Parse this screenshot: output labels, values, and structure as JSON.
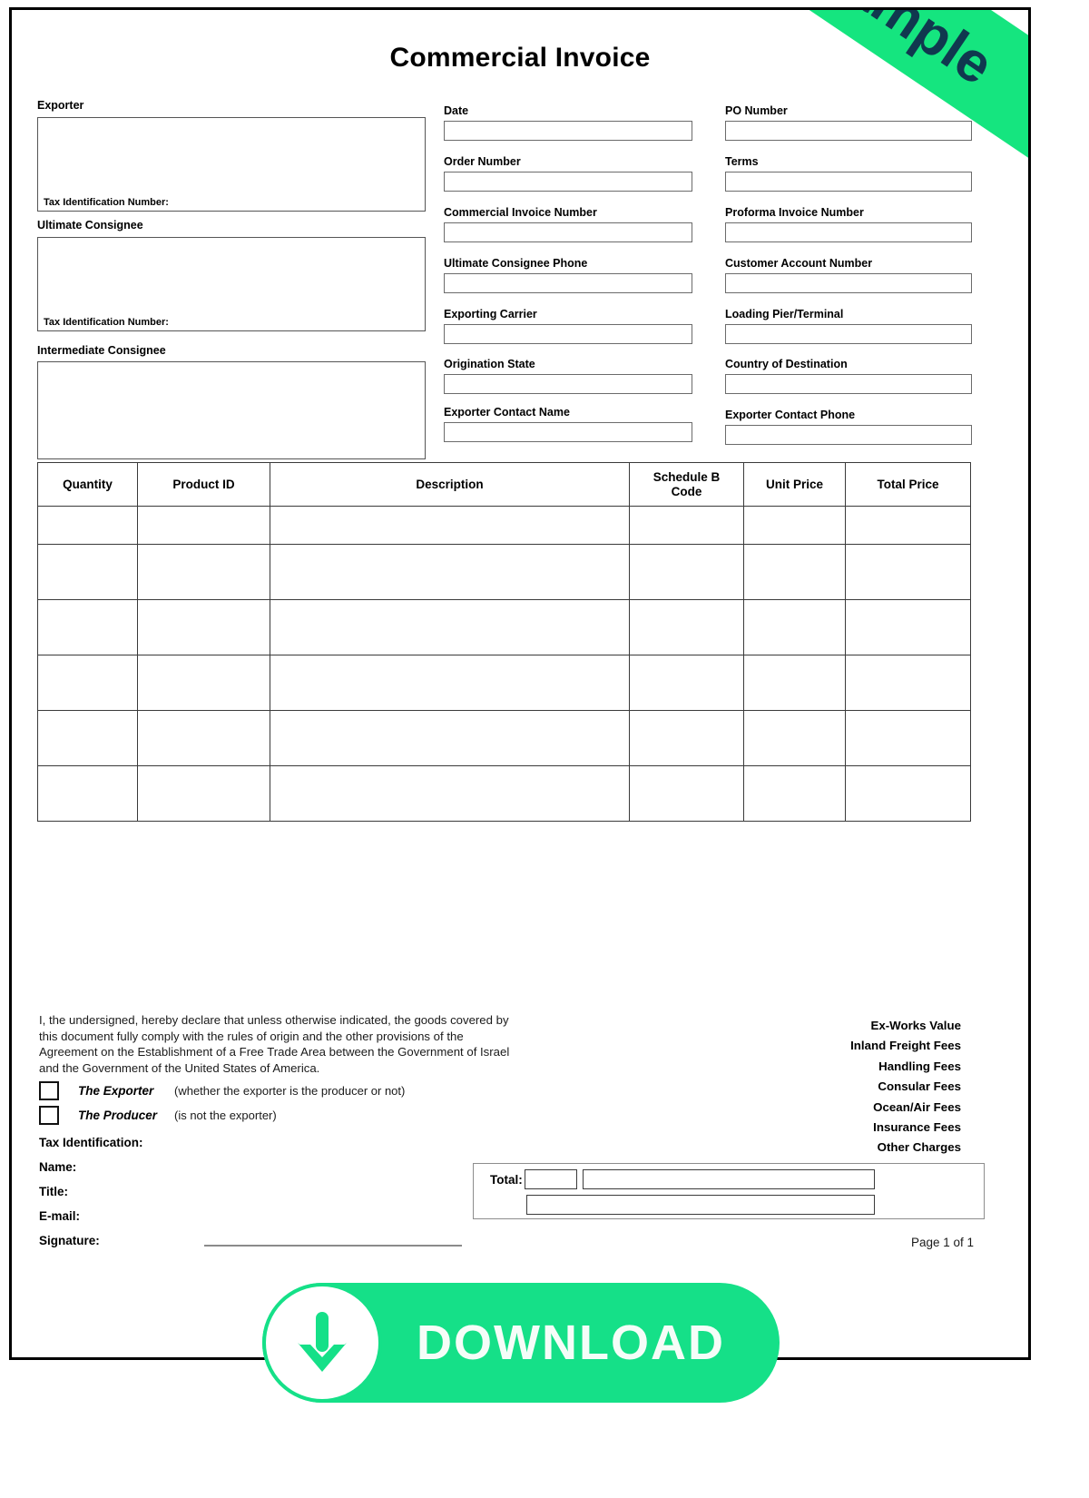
{
  "document": {
    "title": "Commercial Invoice",
    "ribbon_label": "Example",
    "page_number": "Page 1 of 1",
    "accent_green": "#15e088",
    "ribbon_green": "#15e57f",
    "ribbon_text_color": "#10384f"
  },
  "parties": {
    "exporter": {
      "label": "Exporter",
      "tax_id_label": "Tax Identification Number:",
      "value": ""
    },
    "ultimate_consignee": {
      "label": "Ultimate Consignee",
      "tax_id_label": "Tax Identification Number:",
      "value": ""
    },
    "intermediate_consignee": {
      "label": "Intermediate Consignee",
      "value": ""
    }
  },
  "fields_middle": [
    {
      "label": "Date",
      "value": ""
    },
    {
      "label": "Order Number",
      "value": ""
    },
    {
      "label": "Commercial Invoice Number",
      "value": ""
    },
    {
      "label": "Ultimate Consignee Phone",
      "value": ""
    },
    {
      "label": "Exporting Carrier",
      "value": ""
    },
    {
      "label": "Origination State",
      "value": ""
    },
    {
      "label": "Exporter Contact Name",
      "value": ""
    }
  ],
  "fields_right": [
    {
      "label": "PO Number",
      "value": ""
    },
    {
      "label": "Terms",
      "value": ""
    },
    {
      "label": "Proforma Invoice Number",
      "value": ""
    },
    {
      "label": "Customer Account Number",
      "value": ""
    },
    {
      "label": "Loading Pier/Terminal",
      "value": ""
    },
    {
      "label": "Country of Destination",
      "value": ""
    },
    {
      "label": "Exporter Contact Phone",
      "value": ""
    }
  ],
  "items_table": {
    "columns": [
      "Quantity",
      "Product ID",
      "Description",
      "Schedule B Code",
      "Unit Price",
      "Total Price"
    ],
    "rows": [
      [
        "",
        "",
        "",
        "",
        "",
        ""
      ],
      [
        "",
        "",
        "",
        "",
        "",
        ""
      ],
      [
        "",
        "",
        "",
        "",
        "",
        ""
      ],
      [
        "",
        "",
        "",
        "",
        "",
        ""
      ],
      [
        "",
        "",
        "",
        "",
        "",
        ""
      ],
      [
        "",
        "",
        "",
        "",
        "",
        ""
      ]
    ]
  },
  "declaration": {
    "text": "I, the undersigned, hereby declare that unless otherwise indicated, the goods covered by this document fully comply with the rules of origin and the other provisions of the Agreement on the Establishment of a Free Trade Area between the Government of Israel and the Government of the United States of America.",
    "options": [
      {
        "title": "The Exporter",
        "note": "(whether the exporter is the producer or not)",
        "checked": false
      },
      {
        "title": "The Producer",
        "note": "(is not the exporter)",
        "checked": false
      }
    ],
    "signer_fields": [
      {
        "label": "Tax Identification:",
        "value": ""
      },
      {
        "label": "Name:",
        "value": ""
      },
      {
        "label": "Title:",
        "value": ""
      },
      {
        "label": "E-mail:",
        "value": ""
      },
      {
        "label": "Signature:",
        "value": ""
      }
    ]
  },
  "fees": [
    {
      "label": "Ex-Works Value",
      "value": ""
    },
    {
      "label": "Inland Freight Fees",
      "value": ""
    },
    {
      "label": "Handling Fees",
      "value": ""
    },
    {
      "label": "Consular Fees",
      "value": ""
    },
    {
      "label": "Ocean/Air Fees",
      "value": ""
    },
    {
      "label": "Insurance Fees",
      "value": ""
    },
    {
      "label": "Other Charges",
      "value": ""
    }
  ],
  "total": {
    "label": "Total:",
    "currency_value": "",
    "amount_value": "",
    "amount_words_value": ""
  },
  "download": {
    "label": "DOWNLOAD",
    "icon": "download-arrow-icon"
  }
}
